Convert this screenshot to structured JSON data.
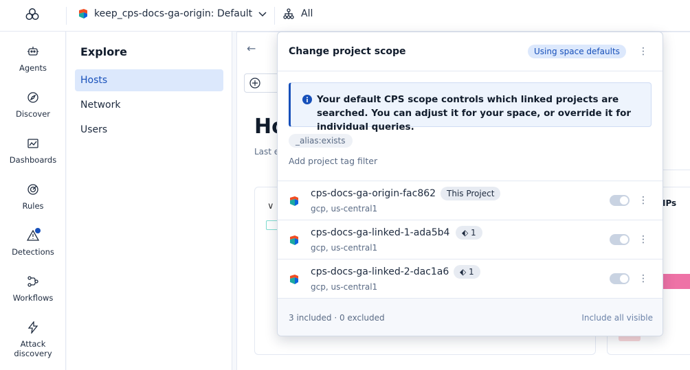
{
  "topbar": {
    "project_selector": "keep_cps-docs-ga-origin: Default",
    "scope_selector": "All"
  },
  "leftnav": {
    "items": [
      {
        "label": "Agents",
        "icon": "robot-icon"
      },
      {
        "label": "Discover",
        "icon": "compass-icon"
      },
      {
        "label": "Dashboards",
        "icon": "dashboard-icon"
      },
      {
        "label": "Rules",
        "icon": "rules-icon"
      },
      {
        "label": "Detections",
        "icon": "warning-icon"
      },
      {
        "label": "Workflows",
        "icon": "workflow-icon"
      },
      {
        "label": "Attack",
        "label2": "discovery",
        "icon": "bolt-icon"
      }
    ]
  },
  "explore": {
    "title": "Explore",
    "items": [
      {
        "label": "Hosts",
        "active": true
      },
      {
        "label": "Network"
      },
      {
        "label": "Users"
      }
    ]
  },
  "main": {
    "title_partial": "Ho",
    "subtitle_partial": "Last e",
    "ips_partial": "IPs"
  },
  "popover": {
    "title": "Change project scope",
    "status_pill": "Using space defaults",
    "callout": "Your default CPS scope controls which linked projects are searched. You can adjust it for your space, or override it for individual queries.",
    "alias_chip": "_alias:exists",
    "add_filter": "Add project tag filter",
    "projects": [
      {
        "name": "cps-docs-ga-origin-fac862",
        "chip": "This Project",
        "meta": "gcp, us-central1",
        "enabled": true
      },
      {
        "name": "cps-docs-ga-linked-1-ada5b4",
        "chip": "1",
        "meta": "gcp, us-central1",
        "enabled": true
      },
      {
        "name": "cps-docs-ga-linked-2-dac1a6",
        "chip": "1",
        "meta": "gcp, us-central1",
        "enabled": true
      }
    ],
    "footer_summary": "3 included · 0 excluded",
    "footer_action": "Include all visible"
  },
  "colors": {
    "accent": "#1750ba",
    "active_bg": "#dce8fc",
    "project_icon_orange": "#f04e23",
    "project_icon_teal": "#1ba9a1"
  }
}
